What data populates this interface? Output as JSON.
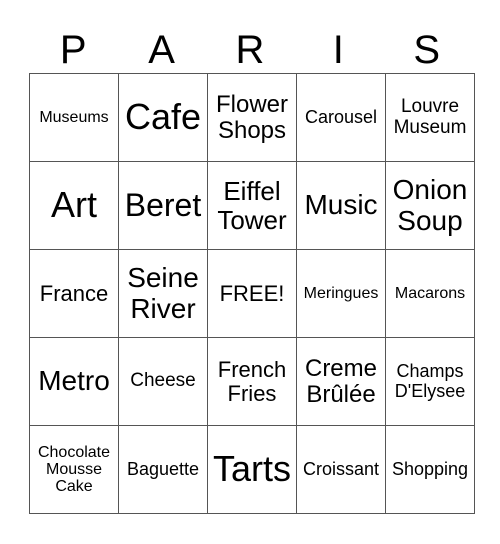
{
  "title_letters": [
    "P",
    "A",
    "R",
    "I",
    "S"
  ],
  "rows": [
    [
      "Museums",
      "Cafe",
      "Flower Shops",
      "Carousel",
      "Louvre Museum"
    ],
    [
      "Art",
      "Beret",
      "Eiffel Tower",
      "Music",
      "Onion Soup"
    ],
    [
      "France",
      "Seine River",
      "FREE!",
      "Meringues",
      "Macarons"
    ],
    [
      "Metro",
      "Cheese",
      "French Fries",
      "Creme Brûlée",
      "Champs D'Elysee"
    ],
    [
      "Chocolate Mousse Cake",
      "Baguette",
      "Tarts",
      "Croissant",
      "Shopping"
    ]
  ]
}
